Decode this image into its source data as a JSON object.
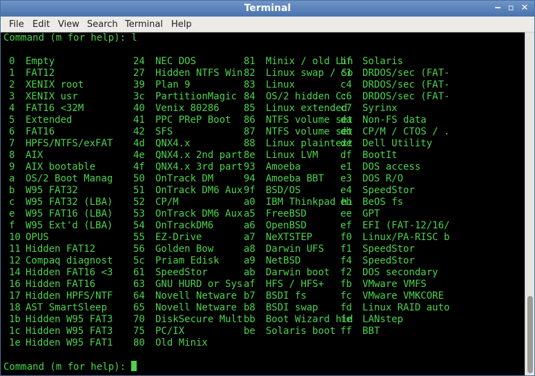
{
  "window": {
    "title": "Terminal"
  },
  "window_controls": {
    "minimize": "‒",
    "maximize": "▫",
    "close": "✕"
  },
  "menu": [
    "File",
    "Edit",
    "View",
    "Search",
    "Terminal",
    "Help"
  ],
  "terminal": {
    "prompt_top": "Command (m for help): l",
    "prompt_bottom": "Command (m for help): ",
    "columns": [
      [
        [
          "0",
          "Empty"
        ],
        [
          "1",
          "FAT12"
        ],
        [
          "2",
          "XENIX root"
        ],
        [
          "3",
          "XENIX usr"
        ],
        [
          "4",
          "FAT16 <32M"
        ],
        [
          "5",
          "Extended"
        ],
        [
          "6",
          "FAT16"
        ],
        [
          "7",
          "HPFS/NTFS/exFAT"
        ],
        [
          "8",
          "AIX"
        ],
        [
          "9",
          "AIX bootable"
        ],
        [
          "a",
          "OS/2 Boot Manag"
        ],
        [
          "b",
          "W95 FAT32"
        ],
        [
          "c",
          "W95 FAT32 (LBA)"
        ],
        [
          "e",
          "W95 FAT16 (LBA)"
        ],
        [
          "f",
          "W95 Ext'd (LBA)"
        ],
        [
          "10",
          "OPUS"
        ],
        [
          "11",
          "Hidden FAT12"
        ],
        [
          "12",
          "Compaq diagnost"
        ],
        [
          "14",
          "Hidden FAT16 <3"
        ],
        [
          "16",
          "Hidden FAT16"
        ],
        [
          "17",
          "Hidden HPFS/NTF"
        ],
        [
          "18",
          "AST SmartSleep"
        ],
        [
          "1b",
          "Hidden W95 FAT3"
        ],
        [
          "1c",
          "Hidden W95 FAT3"
        ],
        [
          "1e",
          "Hidden W95 FAT1"
        ]
      ],
      [
        [
          "24",
          "NEC DOS"
        ],
        [
          "27",
          "Hidden NTFS Win"
        ],
        [
          "39",
          "Plan 9"
        ],
        [
          "3c",
          "PartitionMagic"
        ],
        [
          "40",
          "Venix 80286"
        ],
        [
          "41",
          "PPC PReP Boot"
        ],
        [
          "42",
          "SFS"
        ],
        [
          "4d",
          "QNX4.x"
        ],
        [
          "4e",
          "QNX4.x 2nd part"
        ],
        [
          "4f",
          "QNX4.x 3rd part"
        ],
        [
          "50",
          "OnTrack DM"
        ],
        [
          "51",
          "OnTrack DM6 Aux"
        ],
        [
          "52",
          "CP/M"
        ],
        [
          "53",
          "OnTrack DM6 Aux"
        ],
        [
          "54",
          "OnTrackDM6"
        ],
        [
          "55",
          "EZ-Drive"
        ],
        [
          "56",
          "Golden Bow"
        ],
        [
          "5c",
          "Priam Edisk"
        ],
        [
          "61",
          "SpeedStor"
        ],
        [
          "63",
          "GNU HURD or Sys"
        ],
        [
          "64",
          "Novell Netware"
        ],
        [
          "65",
          "Novell Netware"
        ],
        [
          "70",
          "DiskSecure Mult"
        ],
        [
          "75",
          "PC/IX"
        ],
        [
          "80",
          "Old Minix"
        ]
      ],
      [
        [
          "81",
          "Minix / old Lin"
        ],
        [
          "82",
          "Linux swap / So"
        ],
        [
          "83",
          "Linux"
        ],
        [
          "84",
          "OS/2 hidden C:"
        ],
        [
          "85",
          "Linux extended"
        ],
        [
          "86",
          "NTFS volume set"
        ],
        [
          "87",
          "NTFS volume set"
        ],
        [
          "88",
          "Linux plaintext"
        ],
        [
          "8e",
          "Linux LVM"
        ],
        [
          "93",
          "Amoeba"
        ],
        [
          "94",
          "Amoeba BBT"
        ],
        [
          "9f",
          "BSD/OS"
        ],
        [
          "a0",
          "IBM Thinkpad hi"
        ],
        [
          "a5",
          "FreeBSD"
        ],
        [
          "a6",
          "OpenBSD"
        ],
        [
          "a7",
          "NeXTSTEP"
        ],
        [
          "a8",
          "Darwin UFS"
        ],
        [
          "a9",
          "NetBSD"
        ],
        [
          "ab",
          "Darwin boot"
        ],
        [
          "af",
          "HFS / HFS+"
        ],
        [
          "b7",
          "BSDI fs"
        ],
        [
          "b8",
          "BSDI swap"
        ],
        [
          "bb",
          "Boot Wizard hid"
        ],
        [
          "be",
          "Solaris boot"
        ]
      ],
      [
        [
          "bf",
          "Solaris"
        ],
        [
          "c1",
          "DRDOS/sec (FAT-"
        ],
        [
          "c4",
          "DRDOS/sec (FAT-"
        ],
        [
          "c6",
          "DRDOS/sec (FAT-"
        ],
        [
          "c7",
          "Syrinx"
        ],
        [
          "da",
          "Non-FS data"
        ],
        [
          "db",
          "CP/M / CTOS / ."
        ],
        [
          "de",
          "Dell Utility"
        ],
        [
          "df",
          "BootIt"
        ],
        [
          "e1",
          "DOS access"
        ],
        [
          "e3",
          "DOS R/O"
        ],
        [
          "e4",
          "SpeedStor"
        ],
        [
          "eb",
          "BeOS fs"
        ],
        [
          "ee",
          "GPT"
        ],
        [
          "ef",
          "EFI (FAT-12/16/"
        ],
        [
          "f0",
          "Linux/PA-RISC b"
        ],
        [
          "f1",
          "SpeedStor"
        ],
        [
          "f4",
          "SpeedStor"
        ],
        [
          "f2",
          "DOS secondary"
        ],
        [
          "fb",
          "VMware VMFS"
        ],
        [
          "fc",
          "VMware VMKCORE"
        ],
        [
          "fd",
          "Linux RAID auto"
        ],
        [
          "fe",
          "LANstep"
        ],
        [
          "ff",
          "BBT"
        ]
      ]
    ]
  },
  "colors": {
    "terminal_fg": "#4cd34c",
    "terminal_bg": "#000000",
    "titlebar": "#5a82bb"
  }
}
